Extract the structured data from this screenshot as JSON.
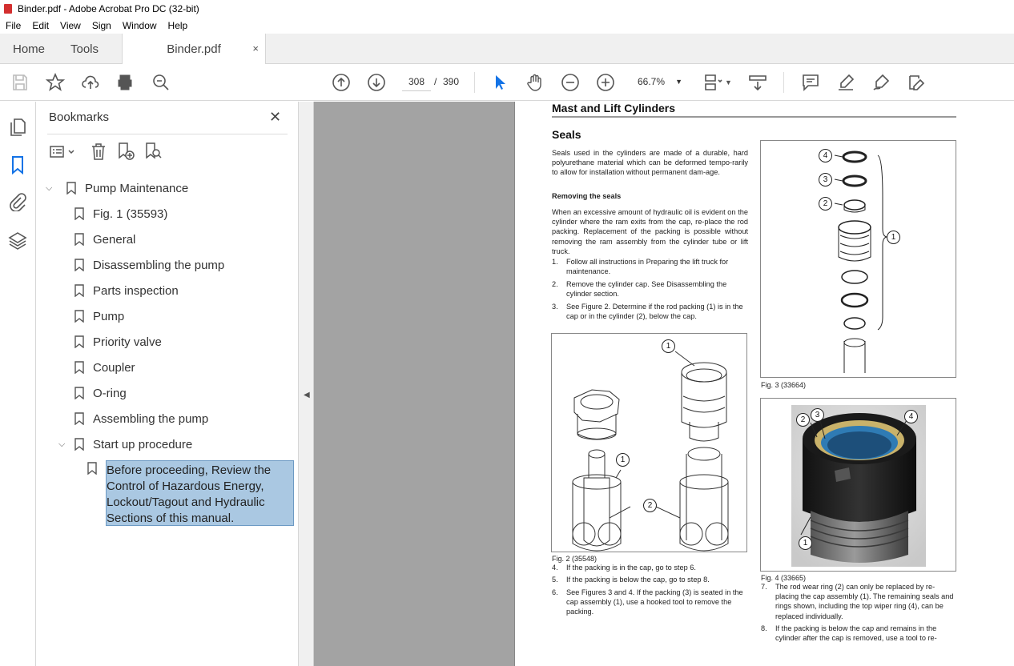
{
  "window": {
    "title": "Binder.pdf - Adobe Acrobat Pro DC (32-bit)"
  },
  "menu": [
    "File",
    "Edit",
    "View",
    "Sign",
    "Window",
    "Help"
  ],
  "tabs": {
    "home": "Home",
    "tools": "Tools",
    "file": "Binder.pdf",
    "close": "×"
  },
  "toolbar": {
    "page_current": "308",
    "page_sep": "/",
    "page_total": "390",
    "zoom": "66.7%"
  },
  "colors": {
    "accent": "#1473e6",
    "selection": "#aac8e2",
    "gray_bg": "#a3a3a3"
  },
  "bookmarks": {
    "title": "Bookmarks",
    "close": "✕",
    "root": "Pump Maintenance",
    "items": [
      "Fig. 1 (35593)",
      "General",
      "Disassembling the pump",
      "Parts inspection",
      "Pump",
      "Priority valve",
      "Coupler",
      "O-ring",
      "Assembling the pump",
      "Start up procedure"
    ],
    "selected_lines": [
      "Before proceeding, Review the",
      "Control of Hazardous Energy,",
      "Lockout/Tagout and Hydraulic",
      "Sections of this manual."
    ]
  },
  "document": {
    "header": "Mast and Lift Cylinders",
    "section": "Seals",
    "intro": "Seals used in the cylinders are made of a durable, hard polyurethane material which can be deformed tempo-rarily to allow for installation without permanent dam-age.",
    "sub": "Removing the seals",
    "para": "When an excessive amount of hydraulic oil is evident on the cylinder where the ram exits from the cap, re-place the rod packing. Replacement of the packing is possible without removing the ram assembly from the cylinder tube or lift truck.",
    "steps_a": [
      {
        "n": "1.",
        "t": "Follow all instructions in Preparing the lift truck for maintenance."
      },
      {
        "n": "2.",
        "t": "Remove the cylinder cap. See Disassembling the cylinder section."
      },
      {
        "n": "3.",
        "t": "See Figure 2. Determine if the rod packing (1) is in the cap or in the cylinder (2), below the cap."
      }
    ],
    "fig2": "Fig. 2 (35548)",
    "steps_b": [
      {
        "n": "4.",
        "t": "If the packing is in the cap, go to step 6."
      },
      {
        "n": "5.",
        "t": "If the packing is below the cap, go to step 8."
      },
      {
        "n": "6.",
        "t": "See Figures 3 and 4. If the packing (3) is seated in the cap assembly (1), use a hooked tool to remove the packing."
      }
    ],
    "fig3": "Fig. 3 (33664)",
    "fig4": "Fig. 4 (33665)",
    "steps_c": [
      {
        "n": "7.",
        "t": "The rod wear ring (2) can only be replaced by re-placing the cap assembly (1). The remaining seals and rings shown, including the top wiper ring (4), can be replaced individually."
      },
      {
        "n": "8.",
        "t": "If the packing is below the cap and remains in the cylinder after the cap is removed, use a tool to re-"
      }
    ],
    "callouts": {
      "c1": "1",
      "c2": "2",
      "c3": "3",
      "c4": "4"
    }
  }
}
